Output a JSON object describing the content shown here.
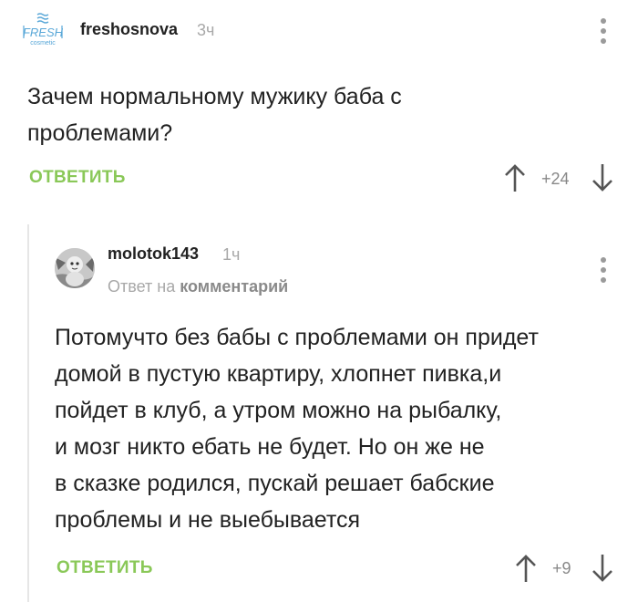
{
  "comment1": {
    "avatar": {
      "brand": "FRESH",
      "sub": "cosmetic",
      "icon": "fresh-cosmetic-logo"
    },
    "username": "freshosnova",
    "time": "3ч",
    "text_lines": [
      "Зачем нормальному мужику баба с",
      "проблемами?"
    ],
    "reply_label": "ОТВЕТИТЬ",
    "score": "+24"
  },
  "comment2": {
    "avatar": {
      "icon": "baby-photo-avatar"
    },
    "username": "molotok143",
    "time": "1ч",
    "reply_to_prefix": "Ответ на",
    "reply_to_link": "комментарий",
    "text_lines": [
      "Потомучто без бабы с проблемами он придет",
      "домой в пустую квартиру, хлопнет пивка,и",
      "пойдет в клуб, а утром можно на рыбалку,",
      "и мозг никто ебать не будет. Но он же не",
      "в сказке родился, пускай решает бабские",
      "проблемы и не выебывается"
    ],
    "reply_label": "ОТВЕТИТЬ",
    "score": "+9"
  },
  "colors": {
    "accent_green": "#8ac858",
    "muted": "#a8a8a8",
    "logo_blue": "#5aa8d8"
  },
  "icons": [
    "more-vertical-icon",
    "arrow-up-icon",
    "arrow-down-icon"
  ]
}
